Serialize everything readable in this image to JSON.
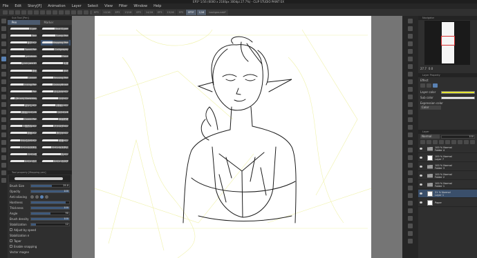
{
  "title": "EP3* 1/16 (6000 x 2100px 300dpi 27.7%) - CLIP STUDIO PAINT EX",
  "menu": [
    "File",
    "Edit",
    "Story[P]",
    "Animation",
    "Layer",
    "Select",
    "View",
    "Filter",
    "Window",
    "Help"
  ],
  "doc_tabs": [
    {
      "label": "EP3",
      "active": false
    },
    {
      "label": "12/16",
      "active": false
    },
    {
      "label": "EP3",
      "active": false
    },
    {
      "label": "13/16",
      "active": false
    },
    {
      "label": "EP3",
      "active": false
    },
    {
      "label": "14/16",
      "active": false
    },
    {
      "label": "EP3",
      "active": false
    },
    {
      "label": "15/16",
      "active": false
    },
    {
      "label": "EP3",
      "active": false
    },
    {
      "label": "EP3*",
      "active": true
    },
    {
      "label": "1/16",
      "active": true
    },
    {
      "label": "backgroundd*",
      "active": false
    }
  ],
  "sub_tool": {
    "header": "Sub Tool [Pen]",
    "tabs": [
      {
        "label": "Pen",
        "active": true
      },
      {
        "label": "Marker",
        "active": false
      }
    ],
    "brushes": [
      {
        "name": "G-pen",
        "selected": false
      },
      {
        "name": "Real G-pen",
        "selected": false
      },
      {
        "name": "Text",
        "selected": false
      },
      {
        "name": "Turnip Pen",
        "selected": false
      },
      {
        "name": "筆字ペン",
        "selected": false
      },
      {
        "name": "Mapping Pen",
        "selected": true
      },
      {
        "name": "Tweet Pen",
        "selected": false
      },
      {
        "name": "Calligraphy",
        "selected": false
      },
      {
        "name": "gokuboso",
        "selected": false
      },
      {
        "name": "Thick",
        "selected": false
      },
      {
        "name": "g-ink pen 01",
        "selected": false
      },
      {
        "name": "毛筆",
        "selected": false
      },
      {
        "name": "線画",
        "selected": false
      },
      {
        "name": "滲み",
        "selected": false
      },
      {
        "name": "Lineart",
        "selected": false
      },
      {
        "name": "Reusing Pen",
        "selected": false
      },
      {
        "name": "Inking Pen",
        "selected": false
      },
      {
        "name": "GalaxyBrush",
        "selected": false
      },
      {
        "name": "Pen",
        "selected": false
      },
      {
        "name": "ほんわかペン",
        "selected": false
      },
      {
        "name": "(Brush) Sketching",
        "selected": false
      },
      {
        "name": "つけペン",
        "selected": false
      },
      {
        "name": "ぼかしペン",
        "selected": false
      },
      {
        "name": "(線画) ペン",
        "selected": false
      },
      {
        "name": "(線画)GペンW",
        "selected": false
      },
      {
        "name": "つけペンB",
        "selected": false
      },
      {
        "name": "Comic Pen",
        "selected": false
      },
      {
        "name": "線画鉛筆",
        "selected": false
      },
      {
        "name": "一般的なペン",
        "selected": false
      },
      {
        "name": "アナログペン",
        "selected": false
      },
      {
        "name": "線画ペン",
        "selected": false
      },
      {
        "name": "滑らかペン",
        "selected": false
      },
      {
        "name": "やわらかGペン",
        "selected": false
      },
      {
        "name": "硬筆ペン",
        "selected": false
      },
      {
        "name": "Gペンカスタム",
        "selected": false
      },
      {
        "name": "Gペンカスタム",
        "selected": false
      },
      {
        "name": "Gペン改",
        "selected": false
      },
      {
        "name": "丸ペン",
        "selected": false
      },
      {
        "name": "Gペン カス",
        "selected": false
      },
      {
        "name": "Gペン カスタ",
        "selected": false
      }
    ]
  },
  "tool_property": {
    "header": "Tool property [Mapping pen]",
    "preview_label": "Mapping pen",
    "rows": [
      {
        "label": "Brush Size",
        "value": "25.0",
        "fill": 0.55,
        "type": "slider"
      },
      {
        "label": "Opacity",
        "value": "100",
        "fill": 1.0,
        "type": "slider"
      },
      {
        "label": "Anti-aliasing",
        "value": "",
        "fill": 0,
        "type": "dots"
      },
      {
        "label": "Hardness",
        "value": "",
        "fill": 0.9,
        "type": "slider"
      },
      {
        "label": "Thickness",
        "value": "100",
        "fill": 1.0,
        "type": "slider"
      },
      {
        "label": "Angle",
        "value": "90",
        "fill": 0.5,
        "type": "slider"
      },
      {
        "label": "Brush density",
        "value": "100",
        "fill": 1.0,
        "type": "slider"
      },
      {
        "label": "Stabilization",
        "value": "12",
        "fill": 0.12,
        "type": "slider"
      },
      {
        "label": "Adjust by speed",
        "value": "",
        "fill": 0,
        "type": "check"
      },
      {
        "label": "Stabilization mode",
        "value": "",
        "fill": 0,
        "type": "blank"
      },
      {
        "label": "Taper",
        "value": "",
        "fill": 0,
        "type": "check"
      },
      {
        "label": "Enable snapping",
        "value": "",
        "fill": 0,
        "type": "check"
      },
      {
        "label": "Vector magnet",
        "value": "",
        "fill": 0,
        "type": "blank"
      }
    ]
  },
  "navigator": {
    "header": "Navigator",
    "zoom": "27.7",
    "rotation": "0.0"
  },
  "layer_property": {
    "header": "Layer Property",
    "effect_label": "Effect",
    "layer_color_label": "Layer color",
    "layer_color": "#e6e632",
    "sub_color_label": "Sub color",
    "sub_color": "#ffffff",
    "expression_label": "Expression color",
    "expression_value": "Color"
  },
  "layer_panel": {
    "header": "Layer",
    "blend_mode": "Normal",
    "opacity": "100",
    "layers": [
      {
        "pct": "100 %",
        "mode": "Normal",
        "name": "Folder 4",
        "kind": "folder",
        "selected": false
      },
      {
        "pct": "100 %",
        "mode": "Normal",
        "name": "Layer 7",
        "kind": "layer",
        "selected": false
      },
      {
        "pct": "100 %",
        "mode": "Normal",
        "name": "Folder 3",
        "kind": "folder",
        "selected": false
      },
      {
        "pct": "100 %",
        "mode": "Normal",
        "name": "Folder 2",
        "kind": "folder",
        "selected": false
      },
      {
        "pct": "100 %",
        "mode": "Normal",
        "name": "Folder 1",
        "kind": "folder",
        "selected": false
      },
      {
        "pct": "31 %",
        "mode": "Normal",
        "name": "Layer 1",
        "kind": "layer",
        "selected": true
      },
      {
        "pct": "",
        "mode": "",
        "name": "Paper",
        "kind": "paper",
        "selected": false
      }
    ]
  },
  "colors": {
    "accent": "#5a82b4",
    "selected_row": "#3a4f6b",
    "guide_line": "#e6e632"
  }
}
